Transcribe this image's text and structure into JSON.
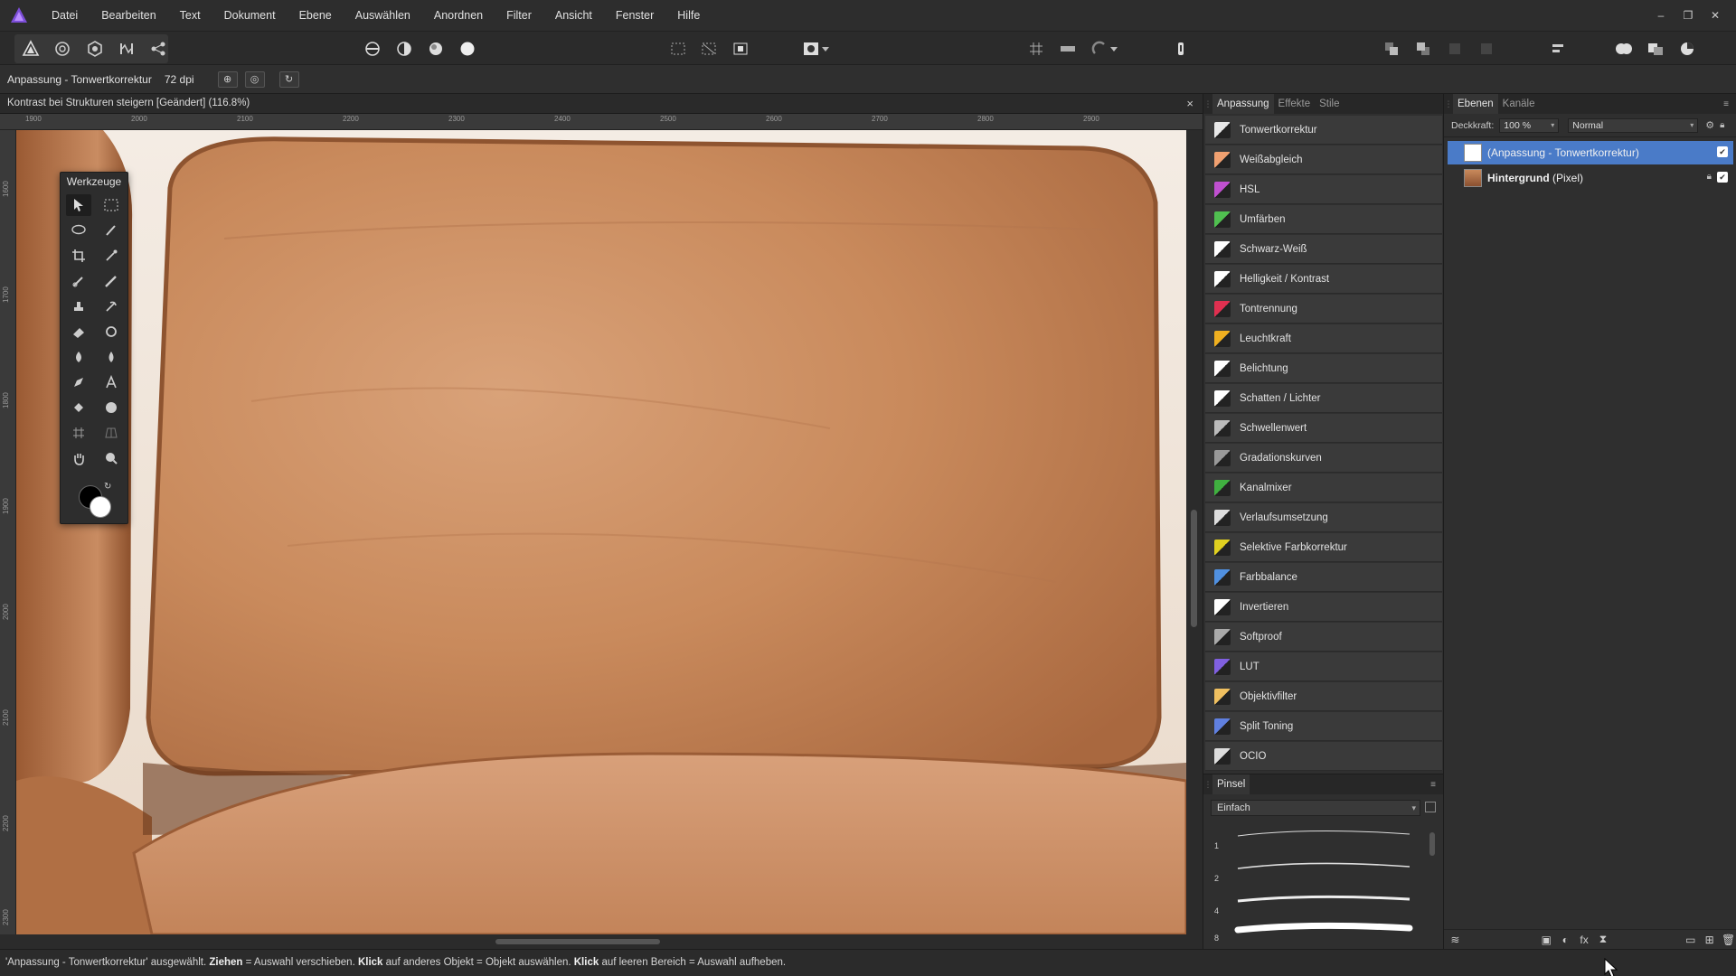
{
  "menubar": {
    "items": [
      "Datei",
      "Bearbeiten",
      "Text",
      "Dokument",
      "Ebene",
      "Auswählen",
      "Anordnen",
      "Filter",
      "Ansicht",
      "Fenster",
      "Hilfe"
    ],
    "window_controls": [
      "–",
      "❐",
      "✕"
    ]
  },
  "contextbar": {
    "title": "Anpassung - Tonwertkorrektur",
    "dpi": "72 dpi"
  },
  "document": {
    "tab_title": "Kontrast bei Strukturen steigern [Geändert] (116.8%)",
    "close": "×",
    "ruler_h": [
      "1900",
      "2000",
      "2100",
      "2200",
      "2300",
      "2400",
      "2500",
      "2600",
      "2700",
      "2800",
      "2900"
    ],
    "ruler_v": [
      "1600",
      "1700",
      "1800",
      "1900",
      "2000",
      "2100",
      "2200",
      "2300"
    ]
  },
  "tools": {
    "title": "Werkzeuge",
    "swap": "↻"
  },
  "adjustments_panel": {
    "tabs": [
      "Anpassung",
      "Effekte",
      "Stile"
    ],
    "items": [
      {
        "label": "Tonwertkorrektur",
        "color": "#e8e8e8"
      },
      {
        "label": "Weißabgleich",
        "color": "#f0a070"
      },
      {
        "label": "HSL",
        "color": "#c050d0"
      },
      {
        "label": "Umfärben",
        "color": "#50c050"
      },
      {
        "label": "Schwarz-Weiß",
        "color": "#ffffff"
      },
      {
        "label": "Helligkeit / Kontrast",
        "color": "#ffffff"
      },
      {
        "label": "Tontrennung",
        "color": "#e03050"
      },
      {
        "label": "Leuchtkraft",
        "color": "#f0b020"
      },
      {
        "label": "Belichtung",
        "color": "#ffffff"
      },
      {
        "label": "Schatten / Lichter",
        "color": "#ffffff"
      },
      {
        "label": "Schwellenwert",
        "color": "#bbbbbb"
      },
      {
        "label": "Gradationskurven",
        "color": "#999999"
      },
      {
        "label": "Kanalmixer",
        "color": "#40b040"
      },
      {
        "label": "Verlaufsumsetzung",
        "color": "#dddddd"
      },
      {
        "label": "Selektive Farbkorrektur",
        "color": "#e0d020"
      },
      {
        "label": "Farbbalance",
        "color": "#5090e0"
      },
      {
        "label": "Invertieren",
        "color": "#ffffff"
      },
      {
        "label": "Softproof",
        "color": "#aaaaaa"
      },
      {
        "label": "LUT",
        "color": "#8060e0"
      },
      {
        "label": "Objektivfilter",
        "color": "#f0c060"
      },
      {
        "label": "Split Toning",
        "color": "#6080e0"
      },
      {
        "label": "OCIO",
        "color": "#dddddd"
      }
    ]
  },
  "brush_panel": {
    "tab": "Pinsel",
    "category": "Einfach",
    "sizes": [
      "1",
      "2",
      "4",
      "8"
    ]
  },
  "layers_panel": {
    "tabs": [
      "Ebenen",
      "Kanäle"
    ],
    "opacity_label": "Deckkraft:",
    "opacity_value": "100 %",
    "blend_mode": "Normal",
    "layers": [
      {
        "name": "(Anpassung - Tonwertkorrektur)",
        "type": "",
        "selected": true
      },
      {
        "name": "Hintergrund",
        "type": "(Pixel)",
        "selected": false
      }
    ]
  },
  "statusbar": {
    "part1": "'Anpassung - Tonwertkorrektur' ausgewählt. ",
    "b1": "Ziehen",
    "part2": " = Auswahl verschieben. ",
    "b2": "Klick",
    "part3": " auf anderes Objekt = Objekt auswählen. ",
    "b3": "Klick",
    "part4": " auf leeren Bereich = Auswahl aufheben."
  },
  "colors": {
    "accent": "#4a7bc8",
    "leather": "#c98a5c"
  }
}
